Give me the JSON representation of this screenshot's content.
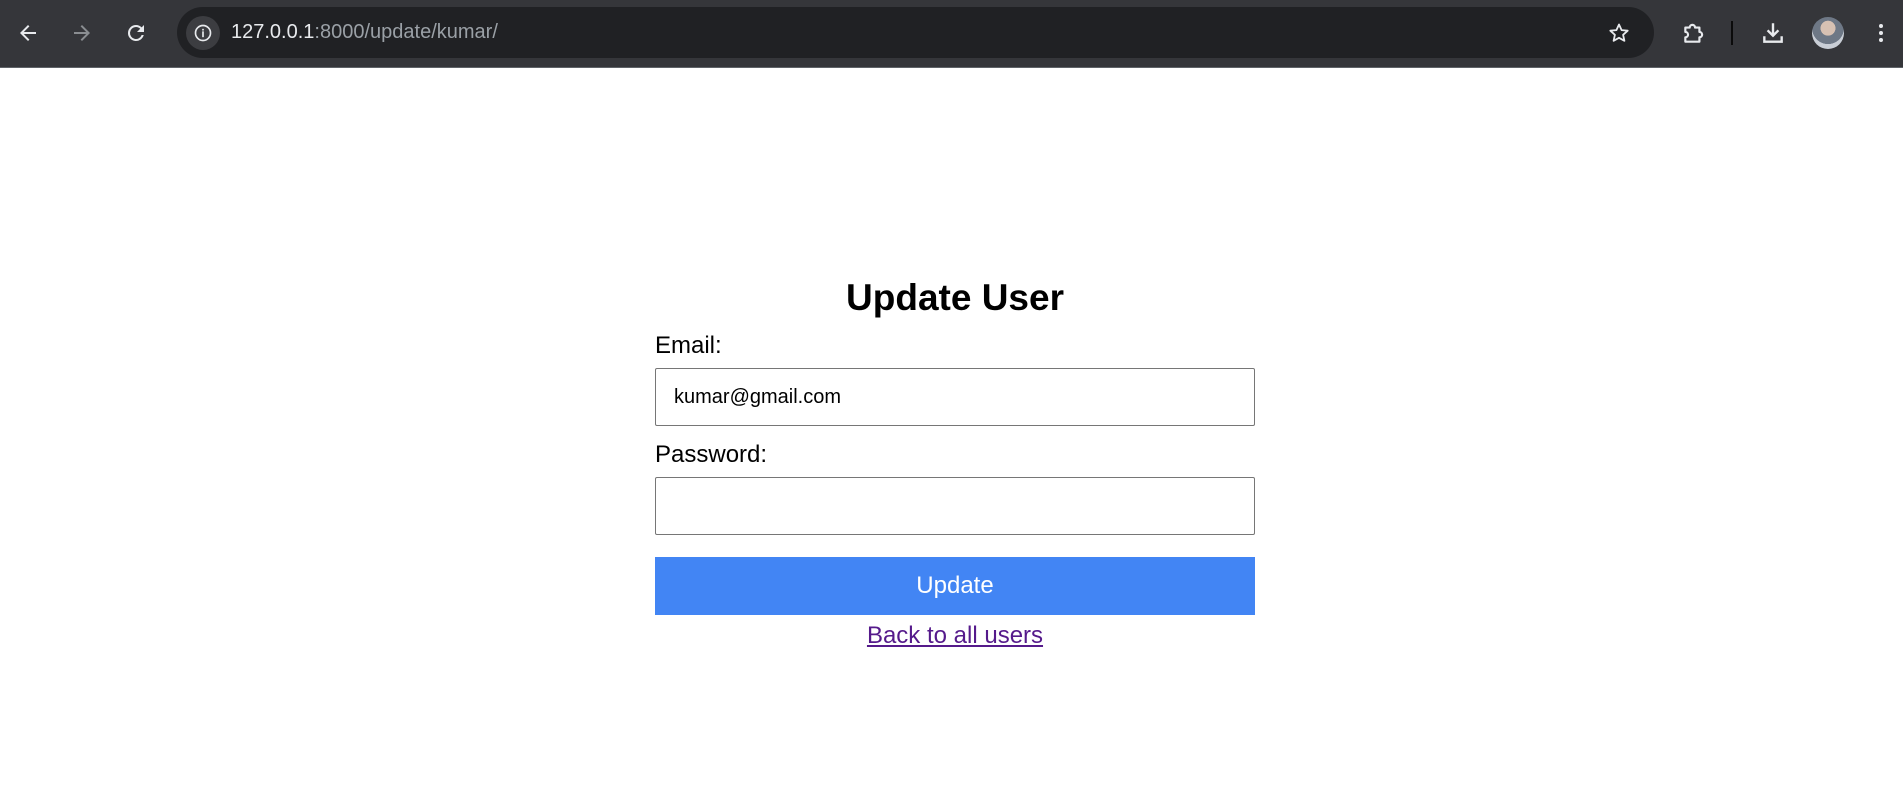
{
  "browser": {
    "url_host": "127.0.0.1",
    "url_rest": ":8000/update/kumar/",
    "toolbar_icon_color": "#e8eaed"
  },
  "page": {
    "title": "Update User",
    "email_label": "Email:",
    "email_value": "kumar@gmail.com",
    "password_label": "Password:",
    "password_value": "",
    "update_button": "Update",
    "back_link": "Back to all users",
    "accent_color": "#4285f4",
    "link_color": "#551a8b"
  },
  "icons": {
    "back": "arrow-left-icon",
    "forward": "arrow-right-icon",
    "reload": "reload-icon",
    "info": "info-icon",
    "bookmark": "star-icon",
    "extensions": "puzzle-icon",
    "downloads": "download-icon",
    "menu": "more-vertical-icon"
  }
}
